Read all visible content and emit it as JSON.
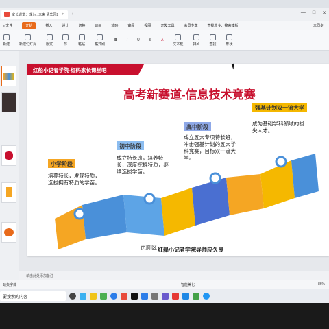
{
  "titlebar": {
    "tab_label": "家长课堂：成为...未来 清华园2",
    "new_tab": "+",
    "window_controls": [
      "—",
      "□",
      "✕"
    ]
  },
  "menubar": {
    "items": [
      "≡ 文件",
      "开始",
      "插入",
      "设计",
      "切换",
      "动画",
      "放映",
      "审阅",
      "视图",
      "开发工具",
      "会员专享",
      "查找命令、搜索模板"
    ],
    "active_index": 1,
    "right": "未同步"
  },
  "ribbon": {
    "items": [
      "新建",
      "新建幻灯片",
      "版式",
      "节",
      "粘贴",
      "格式刷",
      "B",
      "I",
      "U",
      "S",
      "A",
      "文本框",
      "排列",
      "查找",
      "形状"
    ]
  },
  "slide": {
    "header": "红船小记者学院-红码家长课堂吧",
    "title": "高考新赛道-信息技术竞赛",
    "stages": [
      {
        "label": "小学阶段",
        "text": "培养特长，发现特质，选拔拥有特质的学苗。"
      },
      {
        "label": "初中阶段",
        "text": "成立特长班，培养特长，深度挖掘特质，继续选拔学苗。"
      },
      {
        "label": "高中阶段",
        "text": "成立五大专项特长班，冲击强基计划的五大学科竞赛，目标双一流大学。"
      },
      {
        "label": "强基计划双一流大学",
        "text": "成为基础学科领域的拔尖人才。"
      }
    ],
    "footer_left": "页脚区",
    "footer_right": "红船小记者学院导师应久良"
  },
  "notes": "单击此处添加备注",
  "statusbar": {
    "left": "缺失字体",
    "middle": "智能美化",
    "zoom": "86%"
  },
  "taskbar": {
    "search": "要搜索的内容"
  },
  "colors": {
    "accent_orange": "#e86a1a",
    "title_red": "#c8102e",
    "stage1": "#f5a623",
    "stage2": "#4a90d9",
    "stage3": "#4a6fd1",
    "stage4": "#f5b800"
  }
}
